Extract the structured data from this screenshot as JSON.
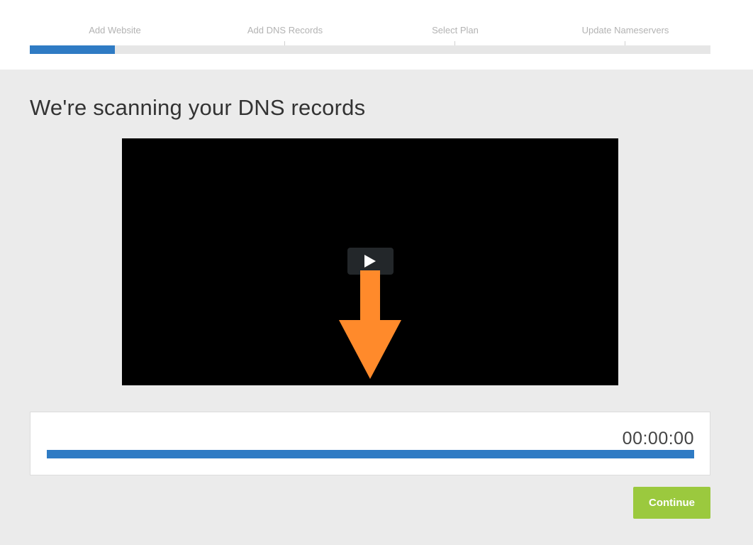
{
  "wizard": {
    "steps": [
      {
        "label": "Add Website"
      },
      {
        "label": "Add DNS Records"
      },
      {
        "label": "Select Plan"
      },
      {
        "label": "Update Nameservers"
      }
    ],
    "progress_fraction": 0.125,
    "accent_color": "#2f7bc4"
  },
  "page": {
    "title": "We're scanning your DNS records"
  },
  "video": {
    "play_icon": "play-icon",
    "overlay_icon": "arrow-down-icon",
    "arrow_color": "#ff8a2b"
  },
  "scan": {
    "elapsed": "00:00:00",
    "progress_fraction": 1.0
  },
  "actions": {
    "continue_label": "Continue",
    "continue_color": "#9bc93e"
  }
}
